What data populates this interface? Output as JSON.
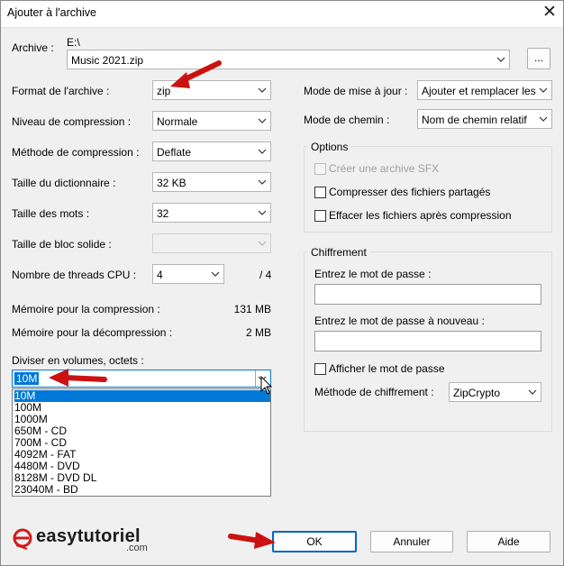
{
  "window": {
    "title": "Ajouter à l'archive",
    "close_glyph": "✕"
  },
  "archive": {
    "label": "Archive :",
    "path": "E:\\",
    "filename": "Music 2021.zip",
    "browse_label": "..."
  },
  "left": {
    "format": {
      "label": "Format de l'archive :",
      "value": "zip"
    },
    "level": {
      "label": "Niveau de compression :",
      "value": "Normale"
    },
    "method": {
      "label": "Méthode de compression :",
      "value": "Deflate"
    },
    "dict": {
      "label": "Taille du dictionnaire :",
      "value": "32 KB"
    },
    "word": {
      "label": "Taille des mots :",
      "value": "32"
    },
    "solid": {
      "label": "Taille de bloc solide :",
      "value": ""
    },
    "threads": {
      "label": "Nombre de threads CPU :",
      "value": "4",
      "max": "/ 4"
    },
    "mem_comp": {
      "label": "Mémoire pour la compression :",
      "value": "131 MB"
    },
    "mem_decomp": {
      "label": "Mémoire pour la décompression :",
      "value": "2 MB"
    },
    "split": {
      "label": "Diviser en volumes, octets :",
      "value": "10M",
      "options": [
        "10M",
        "100M",
        "1000M",
        "650M - CD",
        "700M - CD",
        "4092M - FAT",
        "4480M - DVD",
        "8128M - DVD DL",
        "23040M - BD"
      ],
      "selected_index": 0
    }
  },
  "right": {
    "update_mode": {
      "label": "Mode de mise à jour :",
      "value": "Ajouter et remplacer les fich"
    },
    "path_mode": {
      "label": "Mode de chemin :",
      "value": "Nom de chemin relatif"
    },
    "options": {
      "title": "Options",
      "sfx": {
        "label": "Créer une archive SFX",
        "checked": false,
        "enabled": false
      },
      "shared": {
        "label": "Compresser des fichiers partagés",
        "checked": false
      },
      "delete": {
        "label": "Effacer les fichiers après compression",
        "checked": false
      }
    },
    "encryption": {
      "title": "Chiffrement",
      "pw_label": "Entrez le mot de passe :",
      "pw_value": "",
      "pw2_label": "Entrez le mot de passe à nouveau :",
      "pw2_value": "",
      "show_label": "Afficher le mot de passe",
      "show_checked": false,
      "method_label": "Méthode de chiffrement :",
      "method_value": "ZipCrypto"
    }
  },
  "footer": {
    "ok": "OK",
    "cancel": "Annuler",
    "help": "Aide"
  },
  "watermark": {
    "brand": "easytutoriel",
    "tld": ".com"
  },
  "colors": {
    "arrow": "#cc1111",
    "selection": "#0078d7",
    "primary_border": "#0067c0"
  }
}
